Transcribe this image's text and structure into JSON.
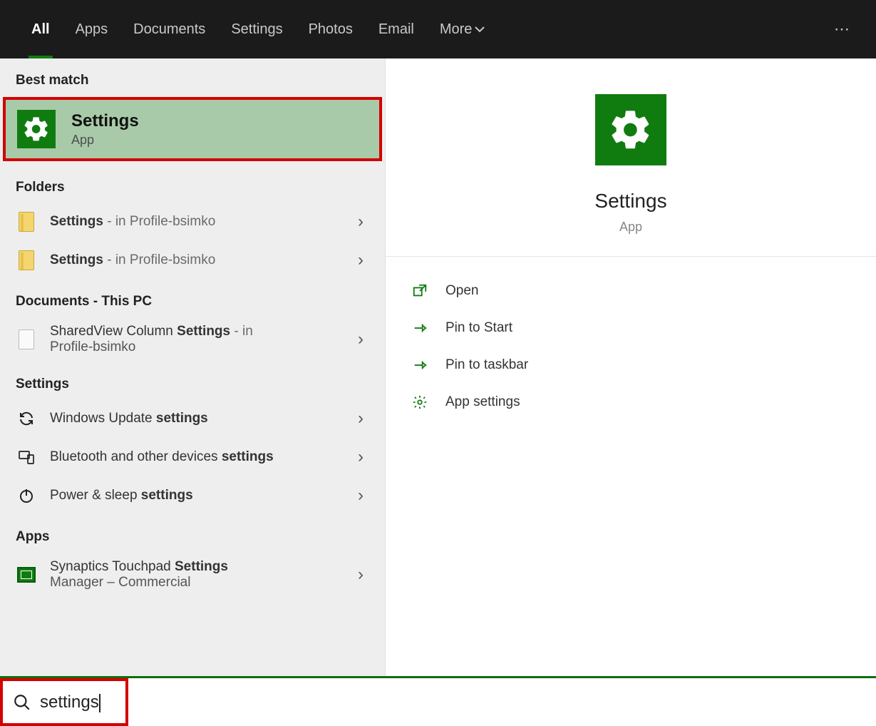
{
  "tabs": {
    "all": "All",
    "apps": "Apps",
    "documents": "Documents",
    "settings": "Settings",
    "photos": "Photos",
    "email": "Email",
    "more": "More"
  },
  "sections": {
    "best_match": "Best match",
    "folders": "Folders",
    "documents_pc": "Documents - This PC",
    "settings": "Settings",
    "apps": "Apps"
  },
  "best_match": {
    "title": "Settings",
    "subtitle": "App"
  },
  "folders": [
    {
      "name": "Settings",
      "location": " - in Profile-bsimko"
    },
    {
      "name": "Settings",
      "location": " - in Profile-bsimko"
    }
  ],
  "documents": [
    {
      "prefix": "SharedView Column ",
      "bold": "Settings",
      "suffix": " - in",
      "line2": "Profile-bsimko"
    }
  ],
  "settings_items": [
    {
      "prefix": "Windows Update ",
      "bold": "settings",
      "icon": "refresh"
    },
    {
      "prefix": "Bluetooth and other devices ",
      "bold": "settings",
      "icon": "devices"
    },
    {
      "prefix": "Power & sleep ",
      "bold": "settings",
      "icon": "power"
    }
  ],
  "apps_items": [
    {
      "prefix": "Synaptics Touchpad ",
      "bold": "Settings",
      "line2": "Manager – Commercial",
      "icon": "touchpad"
    }
  ],
  "preview": {
    "title": "Settings",
    "subtitle": "App"
  },
  "actions": {
    "open": "Open",
    "pin_start": "Pin to Start",
    "pin_taskbar": "Pin to taskbar",
    "app_settings": "App settings"
  },
  "search": {
    "value": "settings"
  }
}
